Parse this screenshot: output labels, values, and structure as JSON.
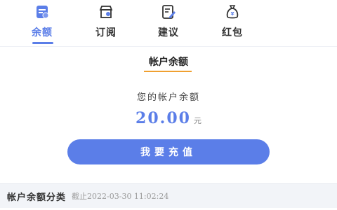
{
  "tabs": [
    {
      "label": "余额",
      "icon": "wallet-icon",
      "active": true
    },
    {
      "label": "订阅",
      "icon": "store-icon",
      "active": false
    },
    {
      "label": "建议",
      "icon": "edit-icon",
      "active": false
    },
    {
      "label": "红包",
      "icon": "money-bag-icon",
      "active": false
    }
  ],
  "section": {
    "title": "帐户余额"
  },
  "balance": {
    "label": "您的帐户余额",
    "amount": "20.00",
    "unit": "元"
  },
  "action": {
    "recharge_label": "我要充值"
  },
  "category": {
    "title": "帐户余额分类",
    "timestamp": "截止2022-03-30 11:02:24"
  },
  "colors": {
    "accent": "#5b7ee8",
    "highlight": "#f0a030"
  }
}
